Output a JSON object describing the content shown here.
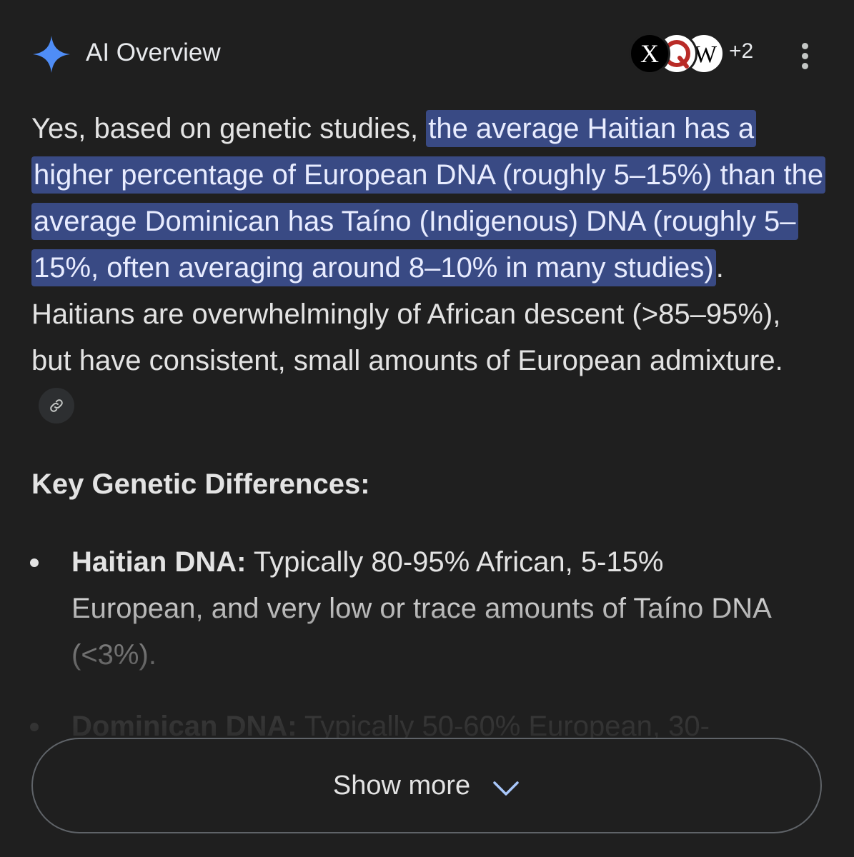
{
  "header": {
    "title": "AI Overview",
    "sources_more_count": "+2",
    "source_icons": [
      "x-icon",
      "quora-icon",
      "wikipedia-icon"
    ],
    "source_icon_letters": [
      "X",
      "Q",
      "W"
    ],
    "sparkle_color": "#4f8df6",
    "menu_icon": "more-vert-icon"
  },
  "answer": {
    "lead": "Yes, based on genetic studies, ",
    "highlight": "the average Haitian has a higher percentage of European DNA (roughly 5–15%) than the average Dominican has Taíno (Indigenous) DNA (roughly 5–15%, often averaging around 8–10% in many studies)",
    "rest": ". Haitians are overwhelmingly of African descent (>85–95%), but have consistent, small amounts of European admixture.",
    "link_icon": "link-icon",
    "highlight_color": "#394a84"
  },
  "section": {
    "title": "Key Genetic Differences:"
  },
  "bullets": [
    {
      "label": "Haitian DNA:",
      "text": " Typically 80-95% African, 5-15% European, and very low or trace amounts of Taíno DNA (<3%)."
    },
    {
      "label": "Dominican DNA:",
      "text": " Typically 50-60% European, 30-"
    }
  ],
  "show_more": {
    "label": "Show more",
    "icon": "chevron-down-icon"
  }
}
